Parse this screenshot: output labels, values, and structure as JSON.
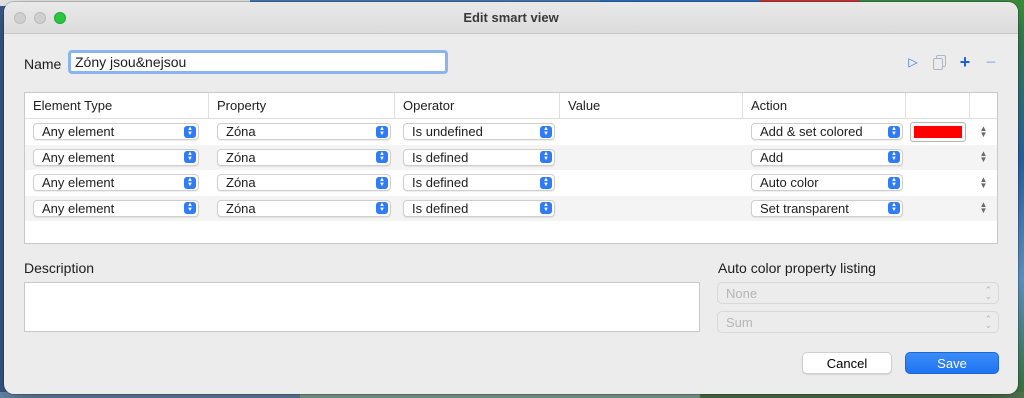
{
  "window": {
    "title": "Edit smart view"
  },
  "name": {
    "label": "Name",
    "value": "Zóny jsou&nejsou"
  },
  "toolbar": {
    "icons": [
      "play-icon",
      "copy-icon",
      "plus-icon",
      "minus-icon"
    ]
  },
  "table": {
    "headers": [
      "Element Type",
      "Property",
      "Operator",
      "Value",
      "Action"
    ],
    "rows": [
      {
        "element_type": "Any element",
        "property": "Zóna",
        "operator": "Is undefined",
        "value": "",
        "action": "Add & set colored",
        "color": "#ff0000"
      },
      {
        "element_type": "Any element",
        "property": "Zóna",
        "operator": "Is defined",
        "value": "",
        "action": "Add"
      },
      {
        "element_type": "Any element",
        "property": "Zóna",
        "operator": "Is defined",
        "value": "",
        "action": "Auto color"
      },
      {
        "element_type": "Any element",
        "property": "Zóna",
        "operator": "Is defined",
        "value": "",
        "action": "Set transparent"
      }
    ]
  },
  "description": {
    "label": "Description",
    "value": ""
  },
  "auto_color": {
    "label": "Auto color property listing",
    "first": "None",
    "second": "Sum"
  },
  "buttons": {
    "cancel": "Cancel",
    "save": "Save"
  },
  "colors": {
    "accent": "#2f7cf6",
    "swatch": "#ff0000",
    "close_green": "#28c840"
  }
}
